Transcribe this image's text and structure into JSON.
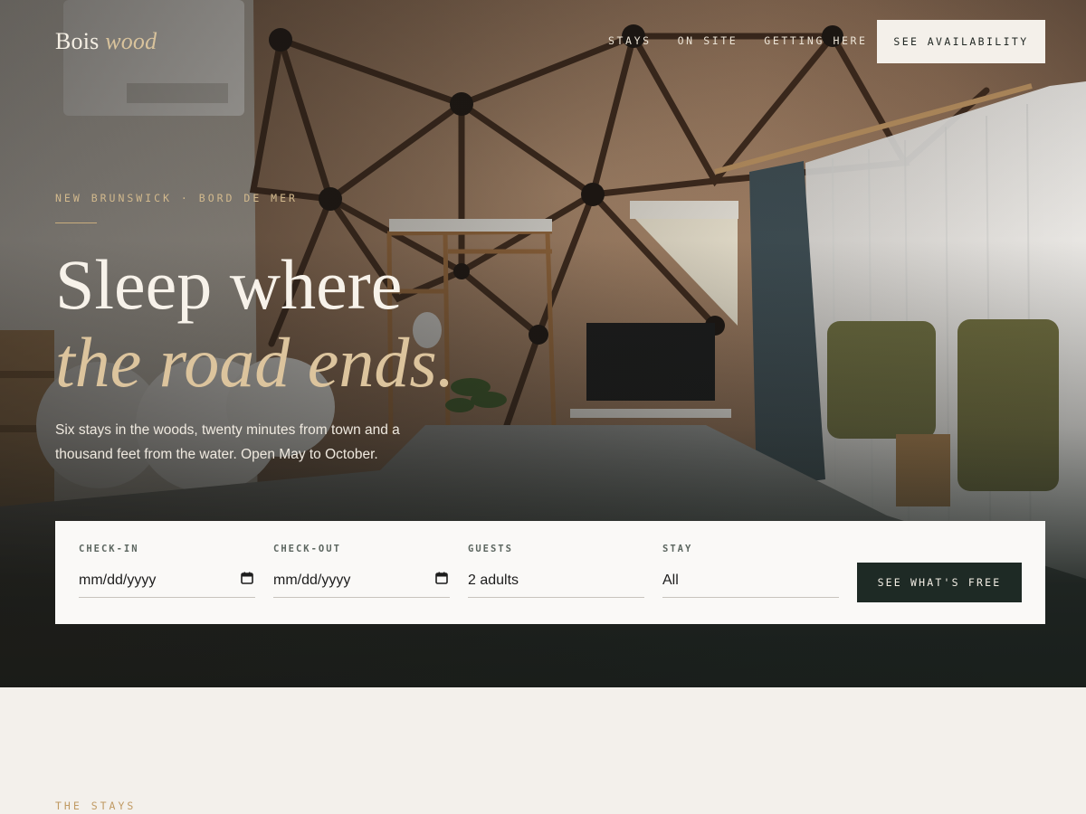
{
  "brand": {
    "name_plain": "Bois",
    "name_italic": "wood"
  },
  "nav": {
    "items": [
      "STAYS",
      "ON SITE",
      "GETTING HERE"
    ],
    "cta": "SEE AVAILABILITY"
  },
  "hero": {
    "eyebrow": "NEW BRUNSWICK · BORD DE MER",
    "headline_line1": "Sleep where",
    "headline_line2": "the road ends.",
    "sub": "Six stays in the woods, twenty minutes from town and a thousand feet from the water. Open May to October."
  },
  "booking": {
    "checkin_label": "CHECK-IN",
    "checkin_value": "mm/dd/yyyy",
    "checkout_label": "CHECK-OUT",
    "checkout_value": "mm/dd/yyyy",
    "guests_label": "GUESTS",
    "guests_value": "2 adults",
    "stay_label": "STAY",
    "stay_value": "All",
    "submit": "SEE WHAT'S FREE"
  },
  "section": {
    "eyebrow": "THE STAYS"
  },
  "icons": {
    "date_picker": "calendar-icon",
    "hero_image": "geodesic-dome-bedroom-photo"
  },
  "colors": {
    "accent_gold": "#d2b98d",
    "dark_green": "#1e2a25",
    "cream": "#f3f0eb"
  }
}
